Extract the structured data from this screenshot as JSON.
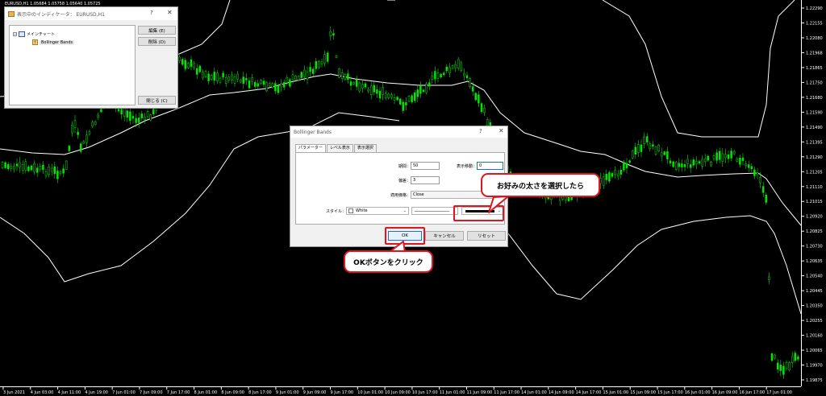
{
  "chart": {
    "symbol_info": "EURUSD,H1  1.05684 1.05758 1.05640 1.05725",
    "price_labels": [
      "1.22290",
      "1.22155",
      "1.22080",
      "1.21968",
      "1.21865",
      "1.21750",
      "1.21680",
      "1.21590",
      "1.21490",
      "1.21395",
      "1.21290",
      "1.21205",
      "1.21110",
      "1.21015",
      "1.20920",
      "1.20825",
      "1.20730",
      "1.20635",
      "1.20540",
      "1.20445",
      "1.20350",
      "1.20255",
      "1.20160",
      "1.20065",
      "1.19970",
      "1.19875"
    ],
    "date_labels": [
      "3 Jun 2021",
      "4 Jun 03:00",
      "4 Jun 11:00",
      "4 Jun 19:00",
      "7 Jun 01:00",
      "7 Jun 09:00",
      "7 Jun 17:00",
      "8 Jun 01:00",
      "8 Jun 09:00",
      "8 Jun 17:00",
      "9 Jun 01:00",
      "9 Jun 09:00",
      "9 Jun 17:00",
      "10 Jun 01:00",
      "10 Jun 09:00",
      "10 Jun 17:00",
      "11 Jun 01:00",
      "11 Jun 09:00",
      "11 Jun 17:00",
      "14 Jun 01:00",
      "14 Jun 09:00",
      "14 Jun 17:00",
      "15 Jun 01:00",
      "15 Jun 09:00",
      "15 Jun 17:00",
      "16 Jun 01:00",
      "16 Jun 09:00",
      "16 Jun 17:00",
      "17 Jun 01:00"
    ],
    "colors": {
      "background": "#000000",
      "candle": "#00e600",
      "band": "#ffffff"
    }
  },
  "indicator_window": {
    "title": "表示中のインディケータ： EURUSD,H1",
    "help": "?",
    "close": "✕",
    "tree": {
      "root": "メインチャート",
      "child": "Bollinger Bands"
    },
    "buttons": {
      "edit": "編集 (E)",
      "delete": "削除 (D)",
      "close": "閉じる (C)"
    }
  },
  "bb_dialog": {
    "title": "Bollinger Bands",
    "help": "?",
    "close": "✕",
    "tabs": [
      "パラメーター",
      "レベル表示",
      "表示選択"
    ],
    "fields": {
      "period_label": "期間：",
      "period_value": "50",
      "shift_label": "表示移動：",
      "shift_value": "0",
      "deviation_label": "偏差：",
      "deviation_value": "3",
      "apply_label": "適用価格：",
      "apply_value": "Close",
      "style_label": "スタイル：",
      "style_color": "White"
    },
    "buttons": {
      "ok": "OK",
      "cancel": "キャンセル",
      "reset": "リセット"
    }
  },
  "callouts": {
    "thickness": "お好みの太さを選択したら",
    "ok": "OKボタンをクリック"
  }
}
